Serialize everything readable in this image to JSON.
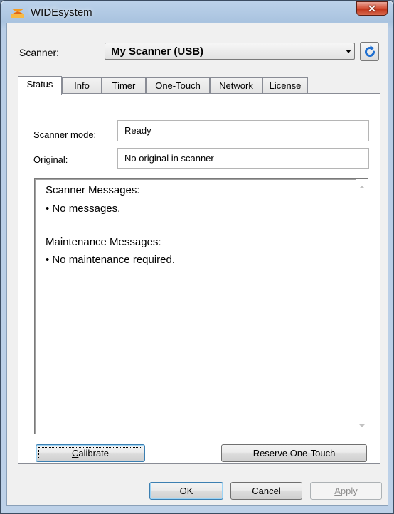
{
  "window": {
    "title": "WIDEsystem",
    "close_label": "✕"
  },
  "scanner": {
    "label": "Scanner:",
    "selected": "My Scanner (USB)"
  },
  "tabs": [
    {
      "label": "Status",
      "active": true
    },
    {
      "label": "Info",
      "active": false
    },
    {
      "label": "Timer",
      "active": false
    },
    {
      "label": "One-Touch",
      "active": false
    },
    {
      "label": "Network",
      "active": false
    },
    {
      "label": "License",
      "active": false
    }
  ],
  "status": {
    "mode_label": "Scanner mode:",
    "mode_value": "Ready",
    "original_label": "Original:",
    "original_value": "No original in scanner"
  },
  "messages": {
    "scanner_heading": "Scanner Messages:",
    "scanner_item": "• No messages.",
    "maintenance_heading": "Maintenance Messages:",
    "maintenance_item": "• No maintenance required."
  },
  "buttons": {
    "calibrate_first": "C",
    "calibrate_rest": "alibrate",
    "reserve": "Reserve One-Touch",
    "ok": "OK",
    "cancel": "Cancel",
    "apply_first": "A",
    "apply_rest": "pply"
  },
  "colors": {
    "accent": "#1f6fd0",
    "close_red": "#c1351b",
    "app_icon_orange": "#f39a1e"
  }
}
